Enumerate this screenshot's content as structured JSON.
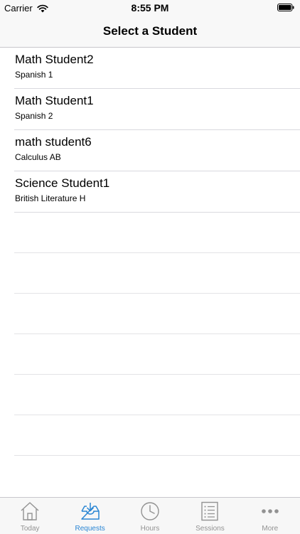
{
  "status_bar": {
    "carrier": "Carrier",
    "time": "8:55 PM",
    "wifi_icon": "wifi-icon",
    "battery_icon": "battery-icon"
  },
  "nav": {
    "title": "Select a Student"
  },
  "students": [
    {
      "name": "Math Student2",
      "course": "Spanish 1"
    },
    {
      "name": "Math Student1",
      "course": "Spanish 2"
    },
    {
      "name": "math student6",
      "course": "Calculus AB"
    },
    {
      "name": "Science Student1",
      "course": "British Literature H"
    }
  ],
  "tabs": [
    {
      "label": "Today",
      "icon": "house-icon",
      "active": false
    },
    {
      "label": "Requests",
      "icon": "inbox-icon",
      "active": true
    },
    {
      "label": "Hours",
      "icon": "clock-icon",
      "active": false
    },
    {
      "label": "Sessions",
      "icon": "list-icon",
      "active": false
    },
    {
      "label": "More",
      "icon": "more-icon",
      "active": false
    }
  ],
  "colors": {
    "accent": "#2a86d4",
    "inactive": "#929292",
    "bar_background": "#f8f8f8",
    "separator": "#d9d9de"
  }
}
